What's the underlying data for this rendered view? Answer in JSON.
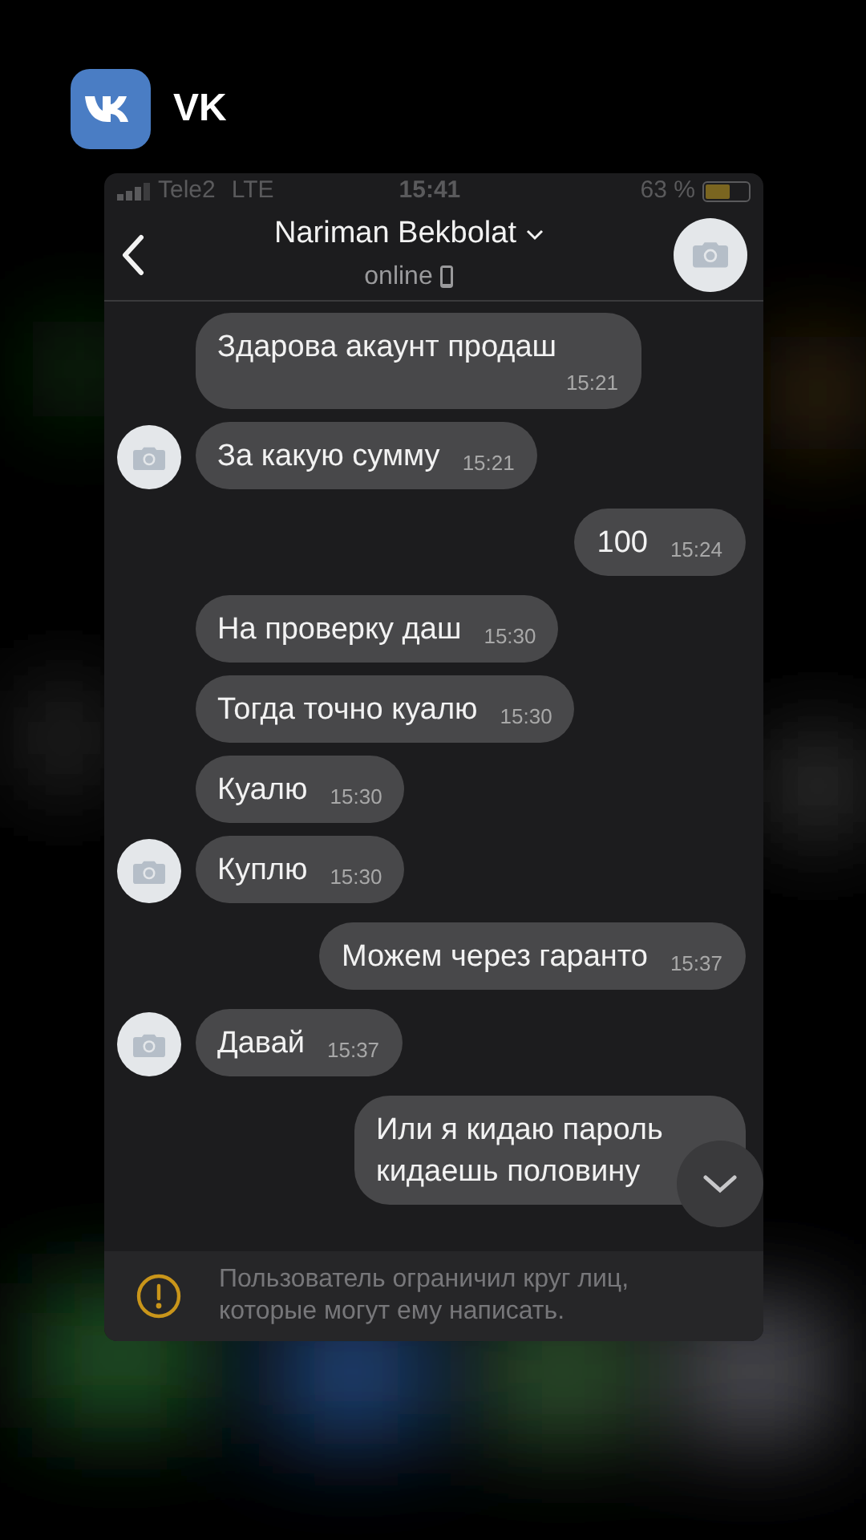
{
  "app": {
    "name": "VK"
  },
  "status_bar": {
    "carrier": "Tele2",
    "network": "LTE",
    "time": "15:41",
    "battery": "63 %"
  },
  "header": {
    "name": "Nariman Bekbolat",
    "status": "online"
  },
  "messages": [
    {
      "text": "Здарова акаунт продаш",
      "time": "15:21",
      "kind": "incoming",
      "avatar": false
    },
    {
      "text": "За какую сумму",
      "time": "15:21",
      "kind": "incoming",
      "avatar": true
    },
    {
      "text": "100",
      "time": "15:24",
      "kind": "outgoing",
      "avatar": false
    },
    {
      "text": "На проверку даш",
      "time": "15:30",
      "kind": "incoming",
      "avatar": false
    },
    {
      "text": "Тогда точно куалю",
      "time": "15:30",
      "kind": "incoming",
      "avatar": false
    },
    {
      "text": "Куалю",
      "time": "15:30",
      "kind": "incoming",
      "avatar": false
    },
    {
      "text": "Куплю",
      "time": "15:30",
      "kind": "incoming",
      "avatar": true
    },
    {
      "text": "Можем через гаранто",
      "time": "15:37",
      "kind": "outgoing",
      "avatar": false
    },
    {
      "text": "Давай",
      "time": "15:37",
      "kind": "incoming",
      "avatar": true
    },
    {
      "text": "Или я кидаю пароль кидаешь половину",
      "kind": "outgoing",
      "avatar": false
    }
  ],
  "notice": {
    "text": "Пользователь ограничил круг лиц, которые могут ему написать."
  }
}
